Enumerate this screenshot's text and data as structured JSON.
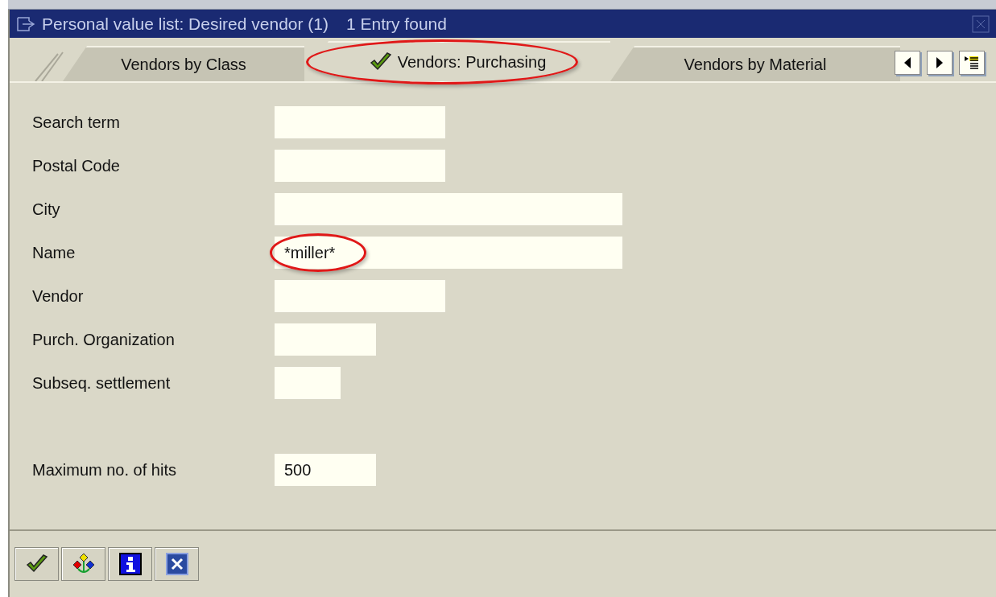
{
  "window": {
    "title": "Personal value list: Desired vendor (1)",
    "status": "1 Entry found"
  },
  "tabs": [
    {
      "label": "Vendors by Class",
      "selected": false,
      "highlighted": false
    },
    {
      "label": "Vendors: Purchasing",
      "selected": true,
      "highlighted": true
    },
    {
      "label": "Vendors by Material",
      "selected": false,
      "highlighted": false
    }
  ],
  "fields": [
    {
      "label": "Search term"
    },
    {
      "label": "Postal Code"
    },
    {
      "label": "City"
    },
    {
      "label": "Name",
      "value": "*miller*",
      "highlighted": true
    },
    {
      "label": "Vendor"
    },
    {
      "label": "Purch. Organization"
    },
    {
      "label": "Subseq. settlement"
    }
  ],
  "max_hits": {
    "label": "Maximum no. of hits",
    "value": "500"
  }
}
